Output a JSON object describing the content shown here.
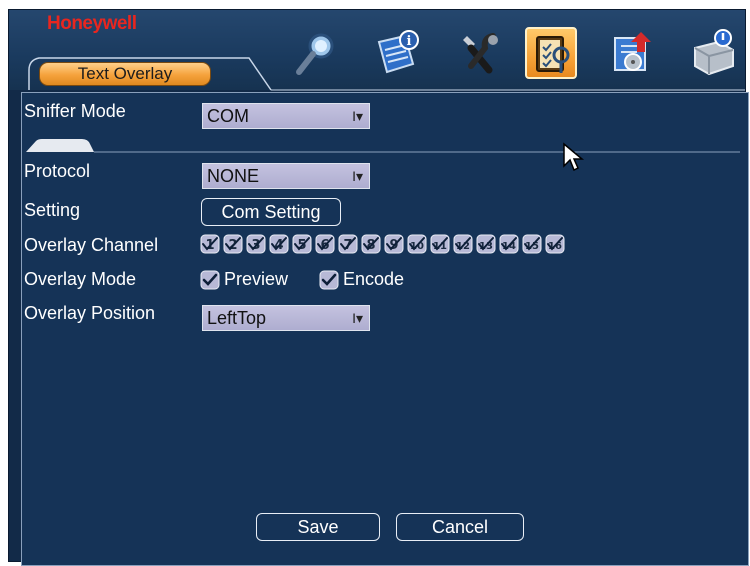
{
  "brand": "Honeywell",
  "active_tab": "Text Overlay",
  "toolbar": {
    "icons": [
      "search-icon",
      "info-icon",
      "tools-icon",
      "clipboard-icon",
      "backup-icon",
      "disk-icon"
    ],
    "active_index": 3
  },
  "form": {
    "sniffer_mode": {
      "label": "Sniffer Mode",
      "value": "COM"
    },
    "protocol": {
      "label": "Protocol",
      "value": "NONE"
    },
    "setting": {
      "label": "Setting",
      "button": "Com Setting"
    },
    "overlay_channel": {
      "label": "Overlay Channel",
      "channels": [
        "1",
        "2",
        "3",
        "4",
        "5",
        "6",
        "7",
        "8",
        "9",
        "10",
        "11",
        "12",
        "13",
        "14",
        "15",
        "16"
      ],
      "all_checked": true
    },
    "overlay_mode": {
      "label": "Overlay Mode",
      "options": [
        {
          "label": "Preview",
          "checked": true
        },
        {
          "label": "Encode",
          "checked": true
        }
      ]
    },
    "overlay_position": {
      "label": "Overlay Position",
      "value": "LeftTop"
    }
  },
  "buttons": {
    "save": "Save",
    "cancel": "Cancel"
  },
  "colors": {
    "brand_red": "#e8261f",
    "active_orange": "#f5a23c",
    "panel_bg": "#153357"
  }
}
